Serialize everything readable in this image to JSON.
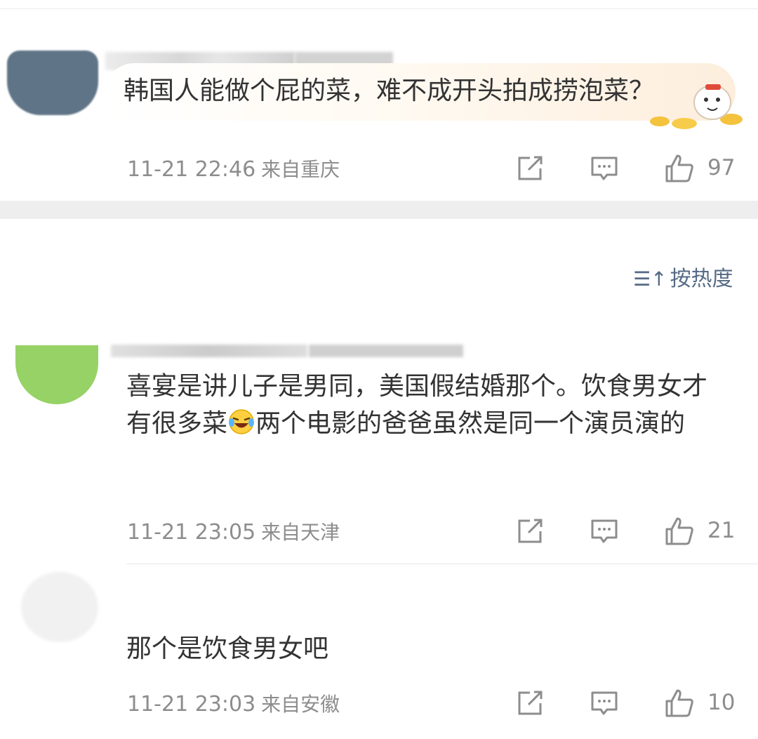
{
  "comments": [
    {
      "text": "韩国人能做个屁的菜，难不成开头拍成捞泡菜？",
      "time": "11-21 22:46",
      "location": "来自重庆",
      "likes": "97"
    },
    {
      "text_before": "喜宴是讲儿子是男同，美国假结婚那个。饮食男女才有很多菜",
      "text_after": "两个电影的爸爸虽然是同一个演员演的",
      "emoji": "laughing-crying-emoji",
      "time": "11-21 23:05",
      "location": "来自天津",
      "likes": "21"
    },
    {
      "text": "那个是饮食男女吧",
      "time": "11-21 23:03",
      "location": "来自安徽",
      "likes": "10"
    }
  ],
  "sort": {
    "label": "按热度",
    "icon": "sort-icon"
  },
  "colors": {
    "meta": "#8d8d8d",
    "sort": "#556a85",
    "separator": "#eeeeee"
  },
  "icons": [
    "share-icon",
    "comment-icon",
    "like-icon"
  ]
}
